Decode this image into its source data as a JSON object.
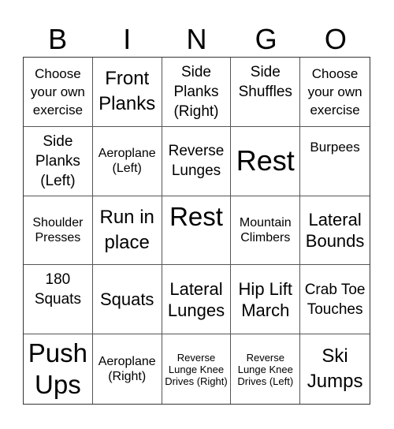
{
  "header": {
    "letters": [
      "B",
      "I",
      "N",
      "G",
      "O"
    ]
  },
  "cells": [
    "Choose your own exercise",
    "Front Planks",
    "Side Planks (Right)",
    "Side Shuffles",
    "Choose your own exercise",
    "Side Planks (Left)",
    "Aeroplane (Left)",
    "Reverse Lunges",
    "Rest",
    "Burpees",
    "Shoulder Presses",
    "Run in place",
    "Rest",
    "Mountain Climbers",
    "Lateral Bounds",
    "180 Squats",
    "Squats",
    "Lateral Lunges",
    "Hip Lift March",
    "Crab Toe Touches",
    "Push Ups",
    "Aeroplane (Right)",
    "Reverse Lunge Knee Drives (Right)",
    "Reverse Lunge Knee Drives (Left)",
    "Ski Jumps"
  ]
}
